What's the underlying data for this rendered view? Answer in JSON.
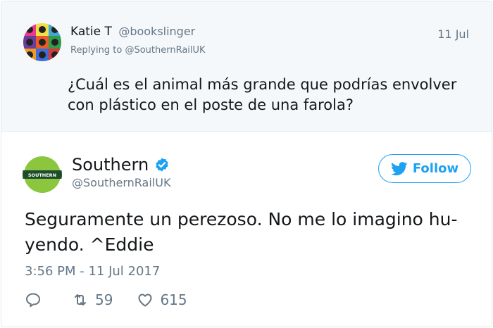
{
  "parent": {
    "name": "Katie T",
    "handle": "@bookslinger",
    "date": "11 Jul",
    "reply_prefix": "Replying to",
    "reply_to": "@SouthernRailUK",
    "text": "¿Cuál es el animal más grande que podrías envolver con plástico en el poste de una farola?"
  },
  "tweet": {
    "name": "Southern",
    "handle": "@SouthernRailUK",
    "follow_label": "Follow",
    "text": "Seguramente un perezoso. No me lo imagino hu-yendo. ^Eddie",
    "timestamp": "3:56 PM - 11 Jul 2017",
    "logo_text": "SOUTHERN",
    "retweets": "59",
    "likes": "615"
  },
  "icons": {
    "verified": "verified-badge-icon",
    "follow": "twitter-bird-icon",
    "reply": "reply-icon",
    "retweet": "retweet-icon",
    "like": "heart-icon"
  },
  "colors": {
    "accent": "#1da1f2",
    "secondary_text": "#657786",
    "parent_bg": "#f5f8fa",
    "southern_green": "#8cc63f",
    "southern_dark": "#1e4d2b"
  }
}
